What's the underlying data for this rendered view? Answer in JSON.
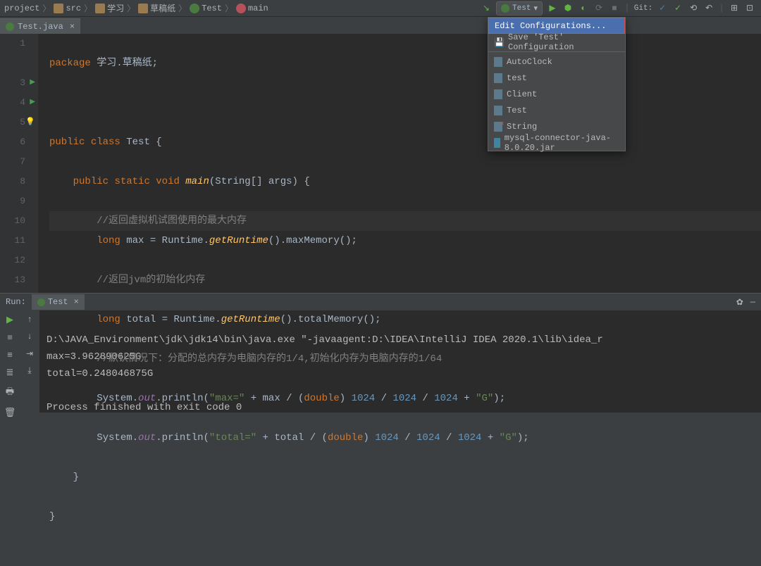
{
  "breadcrumb": [
    "project",
    "src",
    "学习",
    "草稿纸",
    "Test",
    "main"
  ],
  "runconfig": {
    "selected": "Test"
  },
  "git_label": "Git:",
  "tab": {
    "name": "Test.java"
  },
  "dropdown": {
    "edit": "Edit Configurations...",
    "save": "Save 'Test' Configuration",
    "items": [
      "AutoClock",
      "test",
      "Client",
      "Test",
      "String",
      "mysql-connector-java-8.0.20.jar"
    ]
  },
  "code": {
    "l1": {
      "kw": "package",
      "rest": " 学习.草稿纸;"
    },
    "l3": {
      "kw1": "public",
      "kw2": "class",
      "name": "Test",
      "b": "{"
    },
    "l4": {
      "kw1": "public",
      "kw2": "static",
      "kw3": "void",
      "mth": "main",
      "args": "(String[] args) {"
    },
    "l5": "//返回虚拟机试图使用的最大内存",
    "l6": {
      "kw": "long",
      "var": "max",
      "cls": "Runtime",
      "mth1": "getRuntime",
      "mth2": "maxMemory"
    },
    "l7": "//返回jvm的初始化内存",
    "l8": {
      "kw": "long",
      "var": "total",
      "cls": "Runtime",
      "mth1": "getRuntime",
      "mth2": "totalMemory"
    },
    "l9": "//默认情况下：分配的总内存为电脑内存的1/4,初始化内存为电脑内存的1/64",
    "l10": {
      "sys": "System",
      "out": "out",
      "pr": "println",
      "s1": "\"max=\"",
      "var": "max",
      "kw": "double",
      "n": "1024",
      "s2": "\"G\""
    },
    "l11": {
      "sys": "System",
      "out": "out",
      "pr": "println",
      "s1": "\"total=\"",
      "var": "total",
      "kw": "double",
      "n": "1024",
      "s2": "\"G\""
    }
  },
  "run": {
    "label": "Run:",
    "tab": "Test",
    "out1": "D:\\JAVA_Environment\\jdk\\jdk14\\bin\\java.exe \"-javaagent:D:\\IDEA\\IntelliJ IDEA 2020.1\\lib\\idea_r",
    "out2": "max=3.962890625G",
    "out3": "total=0.248046875G",
    "out4": "Process finished with exit code 0"
  }
}
